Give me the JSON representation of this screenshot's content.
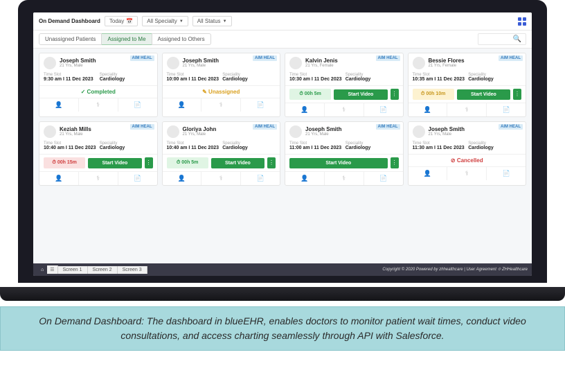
{
  "title": "On Demand Dashboard",
  "filters": {
    "today": "Today",
    "specialty": "All Specialty",
    "status": "All Status"
  },
  "tabs": [
    "Unassigned Patients",
    "Assigned to Me",
    "Assigned to Others"
  ],
  "labels": {
    "timeslot": "Time Slot",
    "speciality": "Speciality",
    "startVideo": "Start Video",
    "completed": "Completed",
    "unassigned": "Unassigned",
    "cancelled": "Cancelled"
  },
  "cards": [
    {
      "name": "Joseph Smith",
      "sub": "21 Yrs, Male",
      "time": "9:30 am I 11 Dec 2023",
      "spec": "Cardiology",
      "action": "completed",
      "badge": "AIM HEAL"
    },
    {
      "name": "Joseph Smith",
      "sub": "21 Yrs, Male",
      "time": "10:00 am I 11 Dec 2023",
      "spec": "Cardiology",
      "action": "unassigned",
      "badge": "AIM HEAL"
    },
    {
      "name": "Kalvin Jenis",
      "sub": "21 Yrs, Female",
      "time": "10:30 am I 11 Dec 2023",
      "spec": "Cardiology",
      "action": "timer-video",
      "timer": "00h 5m",
      "timerClass": "green",
      "badge": "AIM HEAL"
    },
    {
      "name": "Bessie Flores",
      "sub": "21 Yrs, Female",
      "time": "10:35 am I 11 Dec 2023",
      "spec": "Cardiology",
      "action": "timer-video",
      "timer": "00h 10m",
      "timerClass": "yellow",
      "badge": "AIM HEAL"
    },
    {
      "name": "Keziah Mills",
      "sub": "21 Yrs, Male",
      "time": "10:40 am I 11 Dec 2023",
      "spec": "Cardiology",
      "action": "timer-video",
      "timer": "00h 15m",
      "timerClass": "red",
      "badge": "AIM HEAL"
    },
    {
      "name": "Gloriya John",
      "sub": "21 Yrs, Male",
      "time": "10:40 am I 11 Dec 2023",
      "spec": "Cardiology",
      "action": "timer-video",
      "timer": "00h 5m",
      "timerClass": "green",
      "badge": "AIM HEAL"
    },
    {
      "name": "Joseph Smith",
      "sub": "21 Yrs, Male",
      "time": "11:00 am I 11 Dec 2023",
      "spec": "Cardiology",
      "action": "video-full",
      "badge": "AIM HEAL"
    },
    {
      "name": "Joseph Smith",
      "sub": "21 Yrs, Male",
      "time": "11:30 am I 11 Dec 2023",
      "spec": "Cardiology",
      "action": "cancelled",
      "badge": "AIM HEAL"
    }
  ],
  "bottomTabs": [
    "Screen 1",
    "Screen 2",
    "Screen 3"
  ],
  "copyright": "Copyright © 2020 Powered by zhhealthcare | User Agreement ⟐ ZHHealthcare",
  "caption": "On Demand Dashboard: The dashboard in blueEHR, enables doctors to monitor patient wait times, conduct video consultations, and access charting seamlessly through API with Salesforce."
}
